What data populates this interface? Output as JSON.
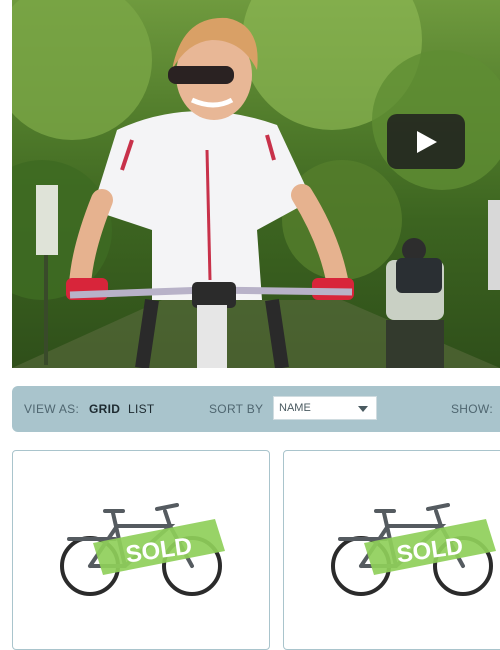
{
  "toolbar": {
    "view_as_label": "VIEW AS:",
    "grid_label": "GRID",
    "list_label": "LIST",
    "sort_by_label": "SORT BY",
    "sort_value": "NAME",
    "show_label": "SHOW:"
  },
  "products": [
    {
      "badge": "SOLD"
    },
    {
      "badge": "SOLD"
    }
  ],
  "colors": {
    "toolbar_bg": "#a9c4cc",
    "sold_badge": "#8fcf5a",
    "play_button": "#1e1e1e"
  }
}
